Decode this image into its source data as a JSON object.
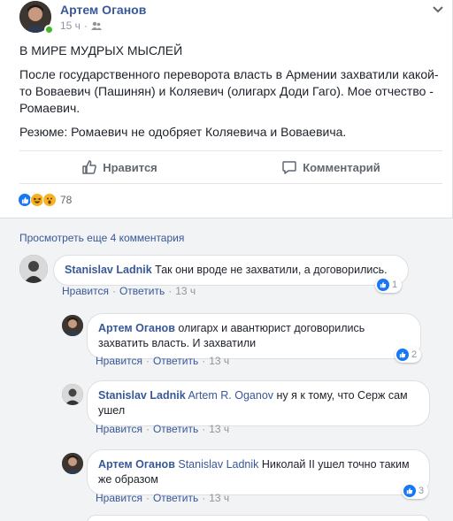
{
  "post": {
    "author": "Артем Оганов",
    "time": "15 ч",
    "paragraphs": [
      "В МИРЕ МУДРЫХ МЫСЛЕЙ",
      "После государственного переворота власть в Армении захватили какой-то Воваевич (Пашинян) и Коляевич (олигарх Доди Гаго). Мое отчество - Ромаевич.",
      "Резюме: Ромаевич не одобряет Коляевича и Воваевича."
    ]
  },
  "actions": {
    "like": "Нравится",
    "comment": "Комментарий"
  },
  "reactions": {
    "count": "78",
    "colors": [
      "#1877f2",
      "#f7b125",
      "#f7b125"
    ]
  },
  "more_comments": "Просмотреть еще 4 комментария",
  "comment_actions": {
    "like": "Нравится",
    "reply": "Ответить",
    "separator": "·"
  },
  "comments": [
    {
      "author": "Stanislav Ladnik",
      "tag": "",
      "text": "Так они вроде не захватили, а договорились.",
      "time": "13 ч",
      "likes": "1"
    },
    {
      "author": "Артем Оганов",
      "tag": "",
      "text": "олигарх и авантюрист договорились захватить власть. И захватили",
      "time": "13 ч",
      "likes": "2"
    },
    {
      "author": "Stanislav Ladnik",
      "tag": "Artem R. Oganov",
      "text": "ну я к тому, что Серж сам ушел",
      "time": "13 ч",
      "likes": ""
    },
    {
      "author": "Артем Оганов",
      "tag": "Stanislav Ladnik",
      "text": "Николай II ушел точно таким же образом",
      "time": "13 ч",
      "likes": "3"
    }
  ]
}
